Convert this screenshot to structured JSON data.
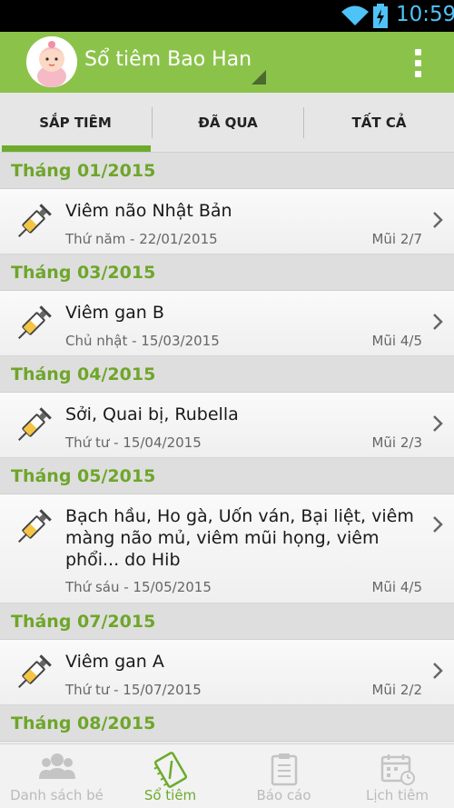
{
  "status_bar": {
    "time": "10:59"
  },
  "app_bar": {
    "title": "Sổ tiêm Bao Han"
  },
  "tabs": [
    {
      "label": "SẮP TIÊM",
      "selected": true
    },
    {
      "label": "ĐÃ QUA",
      "selected": false
    },
    {
      "label": "TẤT CẢ",
      "selected": false
    }
  ],
  "groups": [
    {
      "month": "Tháng 01/2015",
      "item": {
        "name": "Viêm não Nhật Bản",
        "date": "Thứ năm - 22/01/2015",
        "dose": "Mũi 2/7"
      }
    },
    {
      "month": "Tháng 03/2015",
      "item": {
        "name": "Viêm gan B",
        "date": "Chủ nhật - 15/03/2015",
        "dose": "Mũi 4/5"
      }
    },
    {
      "month": "Tháng 04/2015",
      "item": {
        "name": "Sởi, Quai bị, Rubella",
        "date": "Thứ tư - 15/04/2015",
        "dose": "Mũi 2/3"
      }
    },
    {
      "month": "Tháng 05/2015",
      "item": {
        "name": "Bạch hầu, Ho gà, Uốn ván, Bại liệt, viêm màng não mủ, viêm mũi họng, viêm phổi... do Hib",
        "date": "Thứ sáu - 15/05/2015",
        "dose": "Mũi 4/5"
      }
    },
    {
      "month": "Tháng 07/2015",
      "item": {
        "name": "Viêm gan A",
        "date": "Thứ tư - 15/07/2015",
        "dose": "Mũi 2/2"
      }
    },
    {
      "month": "Tháng 08/2015"
    }
  ],
  "bottom_nav": [
    {
      "label": "Danh sách bé",
      "icon": "group-icon",
      "active": false
    },
    {
      "label": "Sổ tiêm",
      "icon": "notebook-syringe-icon",
      "active": true
    },
    {
      "label": "Báo cáo",
      "icon": "clipboard-icon",
      "active": false
    },
    {
      "label": "Lịch tiêm",
      "icon": "calendar-icon",
      "active": false
    }
  ],
  "colors": {
    "accent": "#8bc34a",
    "month_text": "#6ea62a",
    "tab_indicator": "#6cab2c",
    "clock": "#4fc3f7"
  }
}
